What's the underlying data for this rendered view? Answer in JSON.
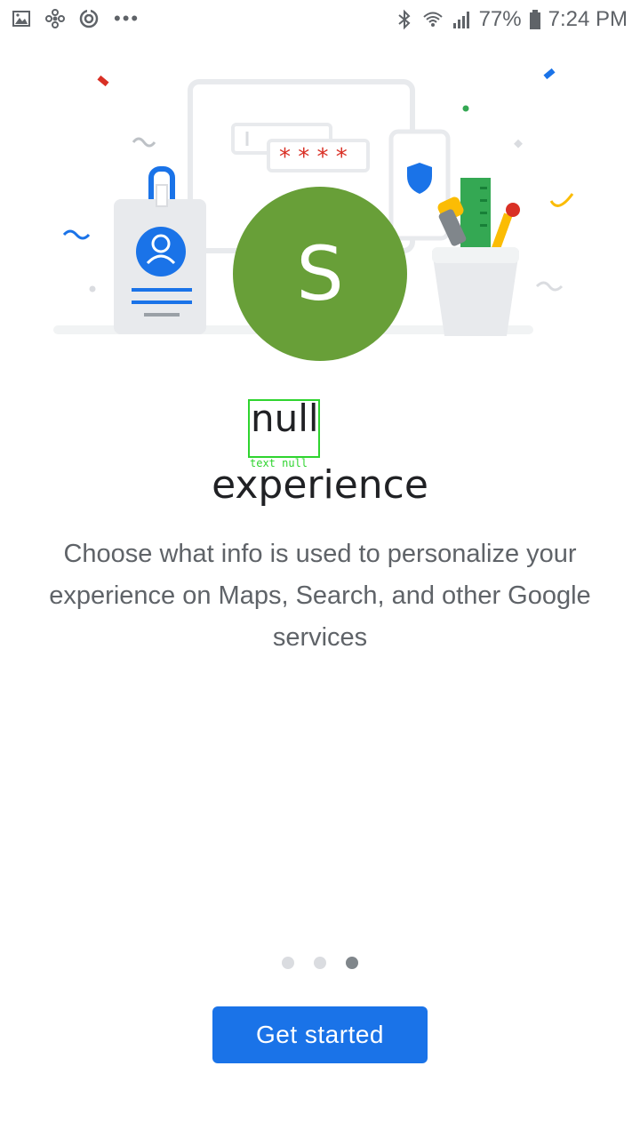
{
  "status_bar": {
    "battery": "77%",
    "time": "7:24 PM",
    "icons": [
      "image-icon",
      "pinwheel-icon",
      "sync-icon",
      "more-icon",
      "bluetooth-icon",
      "wifi-icon",
      "signal-icon",
      "battery-icon"
    ]
  },
  "illustration": {
    "avatar_letter": "S",
    "password_mask": "* * * *"
  },
  "content": {
    "title_top": "null",
    "debug_label": "text null",
    "title_bottom": "experience",
    "description": "Choose what info is used to personalize your experience on Maps, Search, and other Google services"
  },
  "pager": {
    "count": 3,
    "active": 3
  },
  "actions": {
    "get_started": "Get started"
  },
  "colors": {
    "accent": "#1a73e8",
    "avatar": "#689f38",
    "debug_outline": "#2fd42f"
  }
}
